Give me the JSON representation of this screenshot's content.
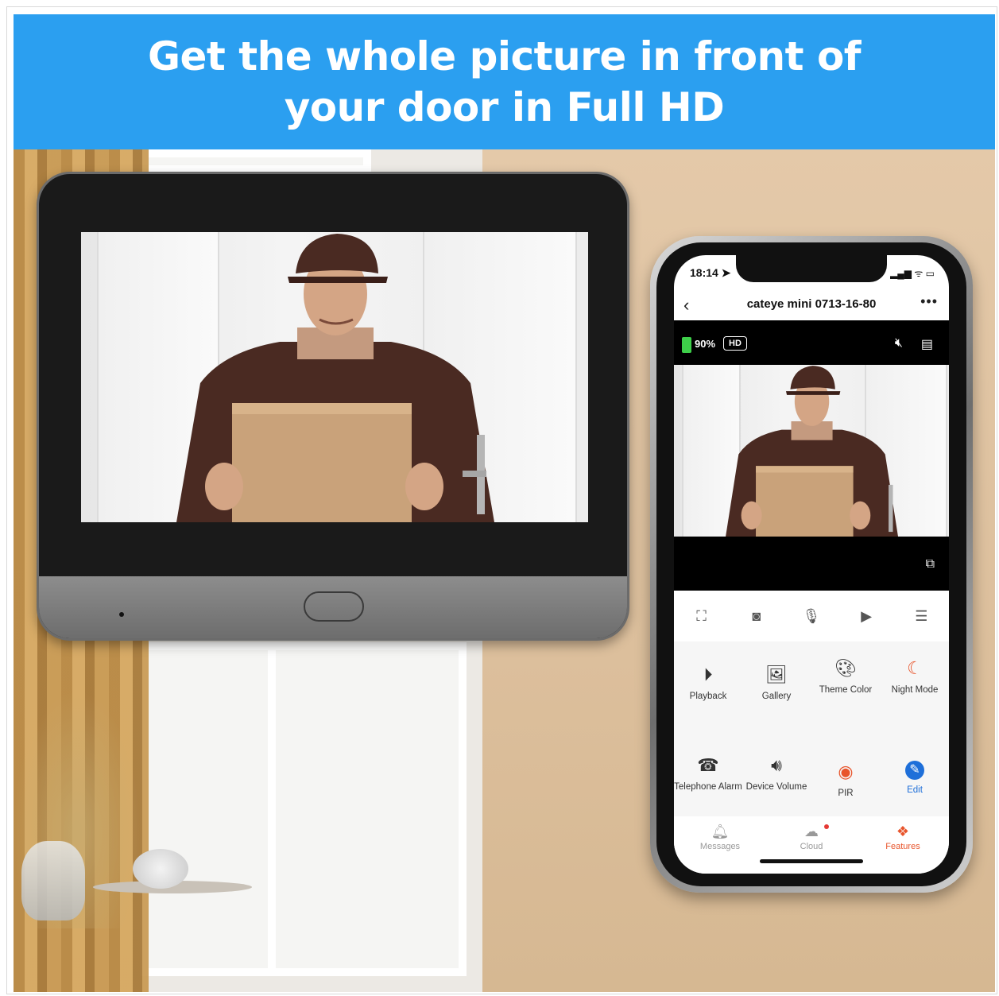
{
  "banner": {
    "headline": "Get the whole picture in front of your door in Full HD"
  },
  "phone": {
    "status": {
      "time": "18:14 ➤",
      "icons": "▂▄▆ ᯤ ▭"
    },
    "app": {
      "title": "cateye mini 0713-16-80",
      "back_icon": "chevron-left",
      "more_icon": "more-horizontal"
    },
    "video": {
      "battery": "90%",
      "quality_badge": "HD"
    },
    "controls": [
      "fullscreen",
      "screenshot",
      "microphone",
      "record",
      "menu"
    ],
    "features": [
      {
        "label": "Playback",
        "icon": "play-circle",
        "color": "#111111"
      },
      {
        "label": "Gallery",
        "icon": "image",
        "color": "#111111"
      },
      {
        "label": "Theme Color",
        "icon": "palette",
        "color": "#111111"
      },
      {
        "label": "Night Mode",
        "icon": "night-mode",
        "color": "#e8552c"
      },
      {
        "label": "Telephone Alarm",
        "icon": "telephone",
        "color": "#111111"
      },
      {
        "label": "Device Volume",
        "icon": "speaker",
        "color": "#111111"
      },
      {
        "label": "PIR",
        "icon": "pir-sensor",
        "color": "#e8552c"
      },
      {
        "label": "Edit",
        "icon": "edit-pencil",
        "color": "#1e6fd9"
      }
    ],
    "tabs": [
      {
        "label": "Messages",
        "icon": "bell",
        "active": false
      },
      {
        "label": "Cloud",
        "icon": "cloud",
        "active": false
      },
      {
        "label": "Features",
        "icon": "features",
        "active": true
      }
    ]
  },
  "colors": {
    "banner": "#2b9ff0",
    "accent": "#e8552c",
    "battery": "#3ecf4a"
  }
}
